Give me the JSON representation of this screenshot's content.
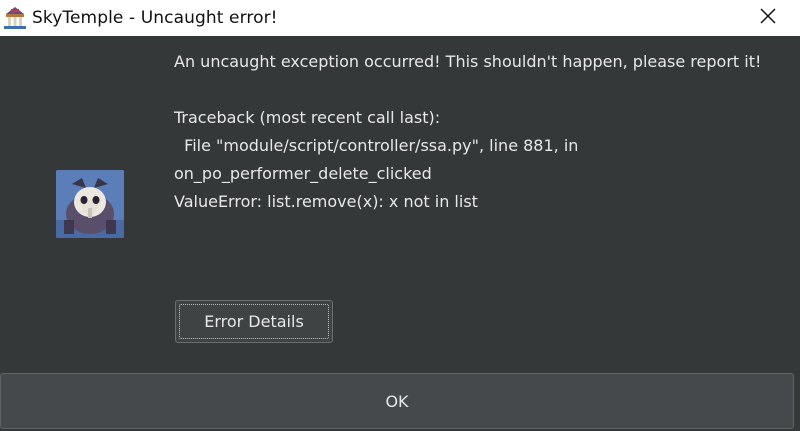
{
  "window": {
    "title": "SkyTemple - Uncaught error!",
    "app_icon": "skytemple-logo-icon",
    "close_icon": "close-icon"
  },
  "dialog": {
    "avatar": "pokemon-portrait-avatar",
    "message_line1": "An uncaught exception occurred! This shouldn't happen, please report it!",
    "traceback_header": "Traceback (most recent call last):",
    "traceback_file": "  File \"module/script/controller/ssa.py\", line 881, in",
    "traceback_function": "on_po_performer_delete_clicked",
    "traceback_error": "ValueError: list.remove(x): x not in list",
    "details_label": "Error Details",
    "ok_label": "OK"
  },
  "colors": {
    "background": "#353839",
    "titlebar": "#ffffff",
    "text": "#e8e8e8",
    "button": "#45494b"
  }
}
